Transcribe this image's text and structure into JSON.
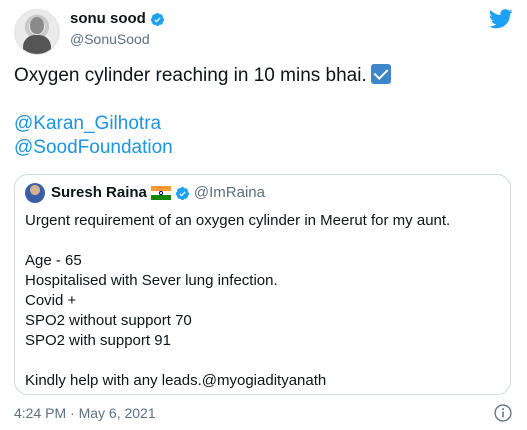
{
  "author": {
    "display_name": "sonu sood",
    "handle": "@SonuSood"
  },
  "tweet": {
    "line1": "Oxygen cylinder reaching in 10 mins bhai.",
    "mention1": "@Karan_Gilhotra",
    "mention2": "@SoodFoundation"
  },
  "quoted": {
    "display_name": "Suresh Raina",
    "handle": "@ImRaina",
    "lines": [
      "Urgent requirement of an oxygen cylinder in Meerut for my aunt.",
      "",
      "Age - 65",
      "Hospitalised with Sever lung infection.",
      "Covid +",
      "SPO2 without support 70",
      "SPO2 with support 91",
      "",
      "Kindly help with any leads.@myogiadityanath"
    ]
  },
  "meta": {
    "timestamp": "4:24 PM · May 6, 2021"
  },
  "icons": {
    "brand": "twitter-bird-icon",
    "verified": "verified-badge-icon",
    "info": "info-icon",
    "check": "check-mark-icon",
    "flag": "india-flag-icon"
  },
  "colors": {
    "brand_blue": "#1da1f2",
    "link_blue": "#1b95e0",
    "muted": "#5b7083",
    "border": "#cfd9de"
  }
}
